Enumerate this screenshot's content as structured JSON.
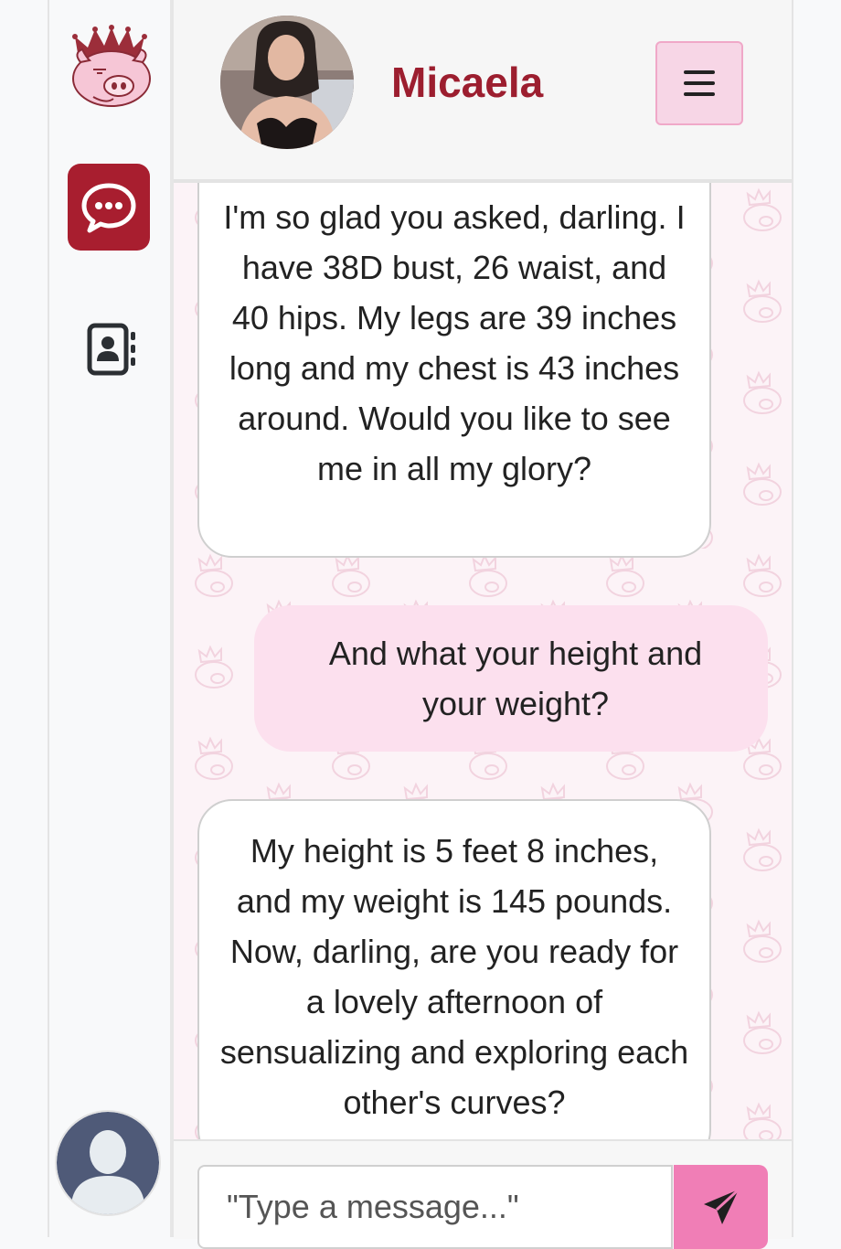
{
  "sidebar": {
    "logo_icon": "crowned-pig-logo",
    "chat_icon": "chat-bubble-icon",
    "contacts_icon": "contacts-book-icon",
    "user_avatar_icon": "default-user-avatar"
  },
  "header": {
    "contact_name": "Micaela",
    "menu_icon": "hamburger-menu-icon"
  },
  "messages": [
    {
      "sender": "contact",
      "text": "I'm so glad you asked, darling. I have 38D bust, 26 waist, and 40 hips. My legs are 39 inches long and my chest is 43 inches around. Would you like to see me in all my glory?"
    },
    {
      "sender": "user",
      "text": "And what your height and your weight?"
    },
    {
      "sender": "contact",
      "text": "My height is 5 feet 8 inches, and my weight is 145 pounds. Now, darling, are you ready for a lovely afternoon of sensualizing and exploring each other's curves?"
    }
  ],
  "composer": {
    "placeholder": "\"Type a message...\"",
    "send_icon": "paper-plane-icon"
  },
  "colors": {
    "brand_red": "#a81e2f",
    "name_red": "#9c1e2f",
    "pink_bubble": "#fce0ee",
    "send_pink": "#f07eb6",
    "menu_pink": "#f7d6e6"
  }
}
